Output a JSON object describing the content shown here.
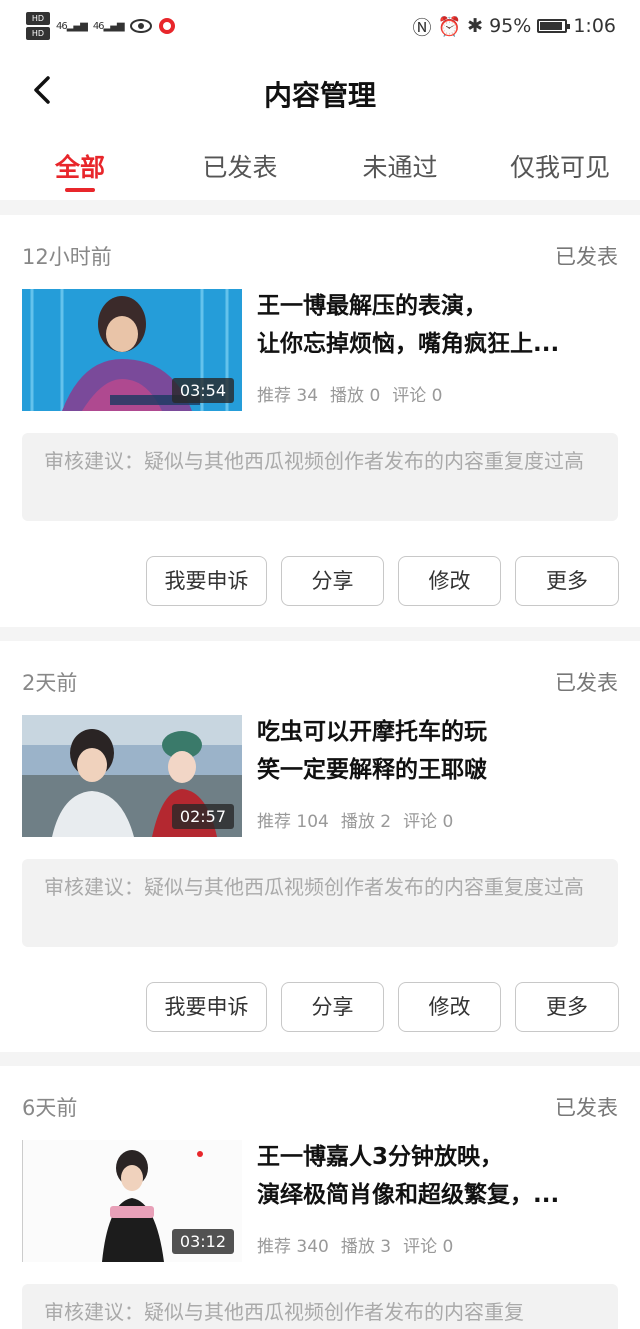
{
  "status_bar": {
    "network_left": "HD",
    "signal1": "46",
    "signal2": "46",
    "battery_percent": "95%",
    "time": "1:06"
  },
  "header": {
    "title": "内容管理",
    "back_icon": "chevron-left-icon"
  },
  "tabs": [
    {
      "label": "全部",
      "active": true
    },
    {
      "label": "已发表",
      "active": false
    },
    {
      "label": "未通过",
      "active": false
    },
    {
      "label": "仅我可见",
      "active": false
    }
  ],
  "posts": [
    {
      "time": "12小时前",
      "status": "已发表",
      "title_line1": "王一博最解压的表演，",
      "title_line2": "让你忘掉烦恼，嘴角疯狂上...",
      "duration": "03:54",
      "recommend": "推荐 34",
      "plays": "播放 0",
      "comments": "评论 0",
      "advice": "审核建议：疑似与其他西瓜视频创作者发布的内容重复度过高",
      "actions": [
        "我要申诉",
        "分享",
        "修改",
        "更多"
      ]
    },
    {
      "time": "2天前",
      "status": "已发表",
      "title_line1": "吃虫可以开摩托车的玩",
      "title_line2": "笑一定要解释的王耶啵",
      "duration": "02:57",
      "recommend": "推荐 104",
      "plays": "播放 2",
      "comments": "评论 0",
      "advice": "审核建议：疑似与其他西瓜视频创作者发布的内容重复度过高",
      "actions": [
        "我要申诉",
        "分享",
        "修改",
        "更多"
      ]
    },
    {
      "time": "6天前",
      "status": "已发表",
      "title_line1": "王一博嘉人3分钟放映，",
      "title_line2": "演绎极简肖像和超级繁复，...",
      "duration": "03:12",
      "recommend": "推荐 340",
      "plays": "播放 3",
      "comments": "评论 0",
      "advice": "审核建议：疑似与其他西瓜视频创作者发布的内容重复",
      "actions": []
    }
  ]
}
